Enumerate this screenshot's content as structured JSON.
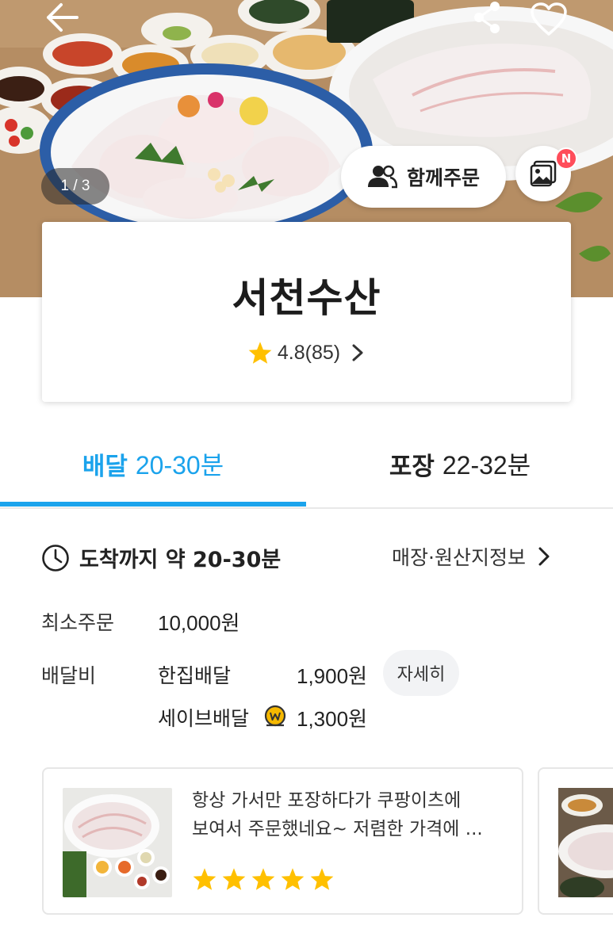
{
  "hero": {
    "image_counter": "1 / 3",
    "group_order_label": "함께주문",
    "photo_badge": "N"
  },
  "store": {
    "name": "서천수산",
    "rating": "4.8(85)"
  },
  "tabs": {
    "delivery": {
      "label": "배달",
      "time": "20-30분"
    },
    "pickup": {
      "label": "포장",
      "time": "22-32분"
    }
  },
  "info": {
    "arrival": "도착까지 약 20-30분",
    "origin_link": "매장·원산지정보",
    "min_order_label": "최소주문",
    "min_order_value": "10,000원",
    "delivery_fee_label": "배달비",
    "single_delivery_label": "한집배달",
    "single_delivery_fee": "1,900원",
    "detail_button": "자세히",
    "save_delivery_label": "세이브배달",
    "save_delivery_fee": "1,300원"
  },
  "reviews": [
    {
      "line1": "항상 가서만 포장하다가 쿠팡이츠에",
      "line2": "보여서 주문했네요~ 저렴한 가격에 ...",
      "rating": 5
    }
  ],
  "colors": {
    "accent": "#1ba3ec",
    "star": "#ffc000",
    "badge": "#ff4d5a"
  },
  "icons": [
    "back-arrow-icon",
    "share-icon",
    "heart-icon",
    "people-icon",
    "photo-album-icon",
    "star-icon",
    "chevron-right-icon",
    "clock-icon",
    "save-coin-icon"
  ]
}
